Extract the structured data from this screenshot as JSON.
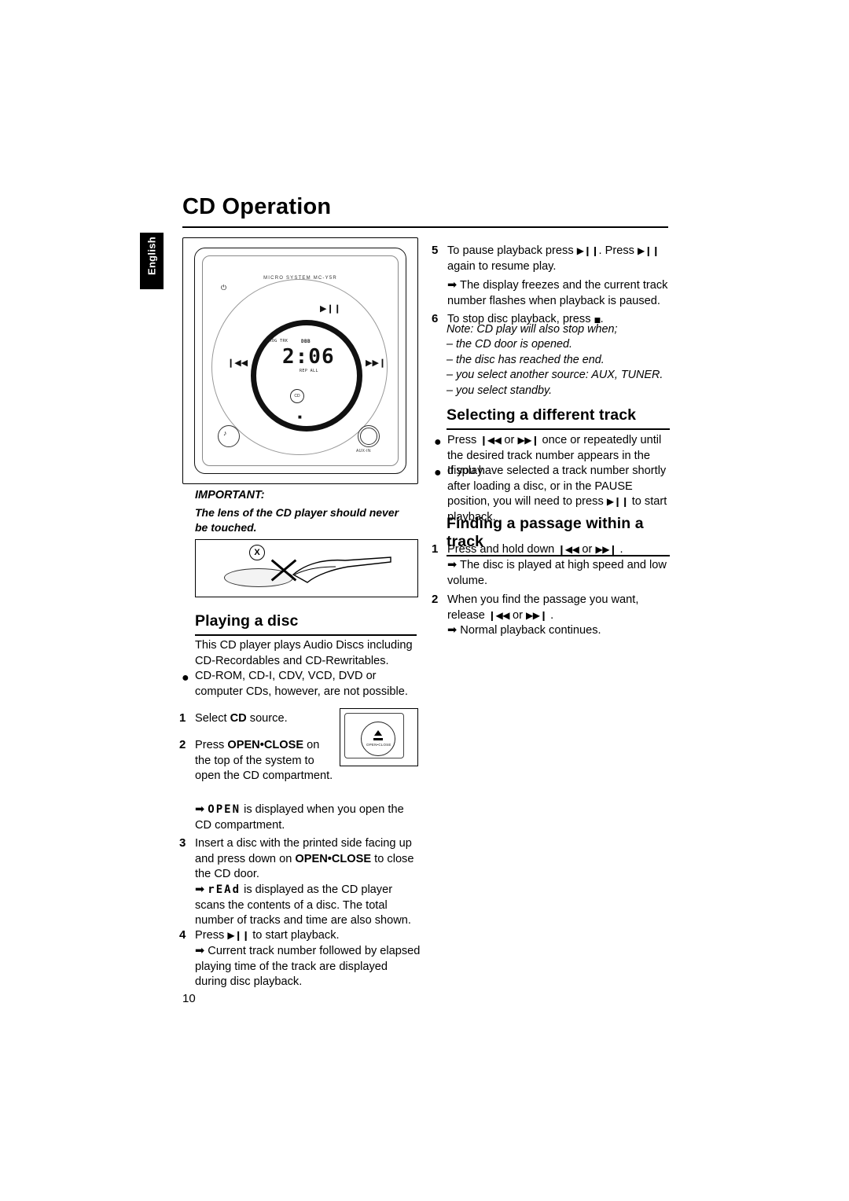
{
  "page": {
    "title": "CD Operation",
    "language_tab": "English",
    "folio": "10"
  },
  "device_figure": {
    "brand": "MICRO SYSTEM MC-Y5R",
    "display": {
      "time": "2:06",
      "label_left": "PROG  TRK",
      "label_dbb": "DBB",
      "label_repeat": "REP ALL",
      "cd_label": "CD"
    },
    "buttons": {
      "play_pause": "▶❙❙",
      "prev": "❙◀◀",
      "next": "▶▶❙",
      "stop": "■",
      "power": "⏻",
      "headphone": "♪",
      "aux_label": "AUX-IN"
    }
  },
  "important": {
    "heading": "IMPORTANT:",
    "text": "The lens of the CD player should never be touched."
  },
  "lens_figure": {
    "x_mark": "X"
  },
  "open_close_figure": {
    "eject_label": "OPEN•CLOSE"
  },
  "sections": {
    "playing_a_disc": {
      "heading": "Playing a disc",
      "intro": "This CD player plays Audio Discs including CD-Recordables and CD-Rewritables.",
      "bullet1": "CD-ROM, CD-I, CDV, VCD, DVD or computer CDs, however, are not possible.",
      "steps": [
        {
          "num": "1",
          "text_before": "Select ",
          "keyword": "CD",
          "text_after": " source."
        },
        {
          "num": "2",
          "text_before": "Press ",
          "keyword": "OPEN•CLOSE",
          "text_after": " on the top of the system to open the CD compartment.",
          "arrow_before": "",
          "arrow_segment": "OPEN",
          "arrow_after": " is displayed when you open the CD compartment."
        },
        {
          "num": "3",
          "text_before": "Insert a disc with the printed side facing up and press down on ",
          "keyword": "OPEN•CLOSE",
          "text_after": " to close the CD door.",
          "arrow_segment": "rEAd",
          "arrow_after": " is displayed as the CD player scans the contents of a disc. The total number of tracks and time are also shown."
        },
        {
          "num": "4",
          "text_before": "Press ",
          "icon": "▶❙❙",
          "text_after": " to start playback.",
          "arrow_text": "Current track number followed by elapsed playing time of the track are displayed during disc playback."
        }
      ]
    },
    "continued_steps": [
      {
        "num": "5",
        "part1": "To pause playback press ",
        "icon1": "▶❙❙",
        "part2": ". Press ",
        "icon2": "▶❙❙",
        "part3": " again to resume play.",
        "arrow_text": "The display freezes and the current track number flashes when playback is paused."
      },
      {
        "num": "6",
        "part1": "To stop disc playback, press ",
        "icon1": "■",
        "part2": "."
      }
    ],
    "note": {
      "lead": "Note: CD play will also stop when;",
      "items": [
        "– the CD door is opened.",
        "– the disc has reached the end.",
        "– you select another source: AUX, TUNER.",
        "– you select standby."
      ]
    },
    "selecting_track": {
      "heading": "Selecting a different track",
      "bullets": [
        {
          "part1": "Press ",
          "icon1": "❙◀◀",
          "part2": " or ",
          "icon2": "▶▶❙",
          "part3": " once or repeatedly until the desired track number appears in the display."
        },
        {
          "part1": "If you have selected a track number shortly after loading a disc, or in the PAUSE position, you will need to press ",
          "icon1": "▶❙❙",
          "part3": " to start playback."
        }
      ]
    },
    "finding_passage": {
      "heading": "Finding a passage within a track",
      "steps": [
        {
          "num": "1",
          "part1": "Press and hold down ",
          "icon1": "❙◀◀",
          "part2": " or ",
          "icon2": "▶▶❙",
          "part3": " .",
          "arrow_text": "The disc is played at high speed and low volume."
        },
        {
          "num": "2",
          "part1": "When you find the passage you want, release ",
          "icon1": "❙◀◀",
          "part2": " or ",
          "icon2": "▶▶❙",
          "part3": " .",
          "arrow_text": "Normal playback continues."
        }
      ]
    }
  }
}
